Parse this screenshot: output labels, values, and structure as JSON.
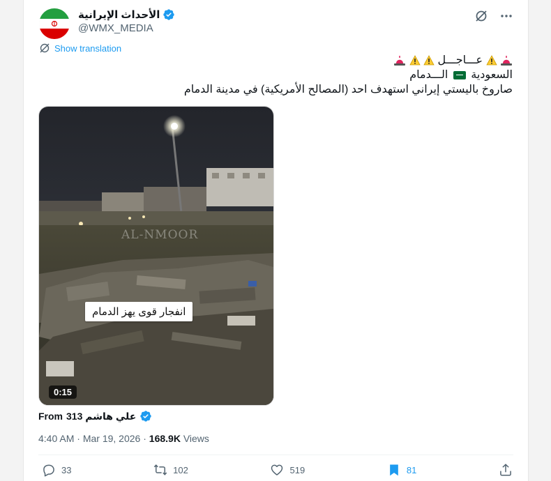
{
  "author": {
    "display_name": "الأحداث الإيرانية",
    "handle": "@WMX_MEDIA"
  },
  "translate_label": "Show translation",
  "tweet_lines": {
    "line1": "عـــاجـــل",
    "line2_a": "السعودية",
    "line2_b": "الـــدمام",
    "line3": "صاروخ باليستي إيراني استهدف احد (المصالح الأمريكية) في مدينة الدمام"
  },
  "media": {
    "caption": "انفجار قوى يهز الدمام",
    "watermark": "AL-NMOOR",
    "duration": "0:15"
  },
  "source": {
    "from_label": "From",
    "name": "علي هاشم 313"
  },
  "meta": {
    "time": "4:40 AM",
    "sep": "·",
    "date": "Mar 19, 2026",
    "views_count": "168.9K",
    "views_label": "Views"
  },
  "actions": {
    "replies": "33",
    "reposts": "102",
    "likes": "519",
    "bookmarks": "81"
  },
  "colors": {
    "accent": "#1d9bf0",
    "secondary_text": "#536471",
    "flag_green": "#006c35",
    "iran_flag_green": "#239f40",
    "iran_flag_red": "#da0000"
  },
  "icons": {
    "verified": "verified-badge-icon",
    "grok": "grok-icon",
    "more": "more-options-icon",
    "translate": "translate-icon",
    "reply": "reply-icon",
    "repost": "repost-icon",
    "like": "like-icon",
    "bookmark": "bookmark-icon",
    "share": "share-icon"
  }
}
